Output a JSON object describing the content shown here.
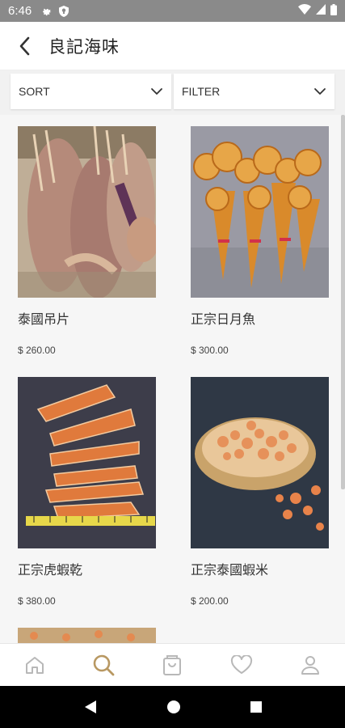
{
  "status_bar": {
    "time": "6:46"
  },
  "header": {
    "title": "良記海味",
    "back_icon": "chevron-left-icon"
  },
  "toolbar": {
    "sort_label": "SORT",
    "filter_label": "FILTER"
  },
  "products": [
    {
      "name": "泰國吊片",
      "price": "$ 260.00",
      "image": "dried squid"
    },
    {
      "name": "正宗日月魚",
      "price": "$ 300.00",
      "image": "dried scallop bundles"
    },
    {
      "name": "正宗虎蝦乾",
      "price": "$ 380.00",
      "image": "dried tiger prawns"
    },
    {
      "name": "正宗泰國蝦米",
      "price": "$ 200.00",
      "image": "dried shrimp in bamboo tray"
    }
  ],
  "bottom_nav": [
    {
      "icon": "home-icon",
      "active": false
    },
    {
      "icon": "search-icon",
      "active": true
    },
    {
      "icon": "shopping-bag-icon",
      "active": false
    },
    {
      "icon": "heart-icon",
      "active": false
    },
    {
      "icon": "user-icon",
      "active": false
    }
  ],
  "colors": {
    "accent": "#b89862",
    "nav_inactive": "#b8b8b8",
    "status_bar": "#8a8a8a"
  }
}
